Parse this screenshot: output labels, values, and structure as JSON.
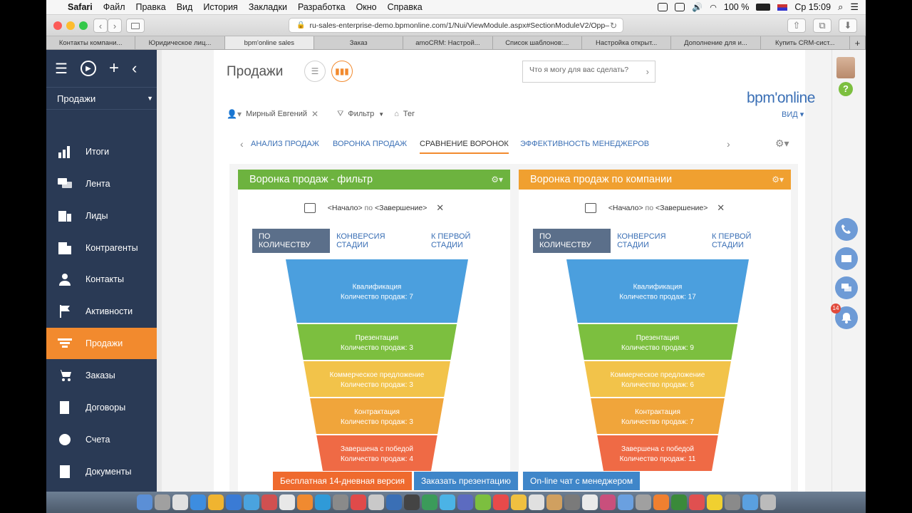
{
  "menubar": {
    "items": [
      "Safari",
      "Файл",
      "Правка",
      "Вид",
      "История",
      "Закладки",
      "Разработка",
      "Окно",
      "Справка"
    ],
    "battery": "100 %",
    "clock": "Ср 15:09"
  },
  "browser": {
    "url": "ru-sales-enterprise-demo.bpmonline.com/1/Nui/ViewModule.aspx#SectionModuleV2/Opp–",
    "tabs": [
      "Контакты компани...",
      "Юридическое лиц...",
      "bpm'online sales",
      "Заказ",
      "amoCRM: Настрой...",
      "Список шаблонов:...",
      "Настройка открыт...",
      "Дополнение для и...",
      "Купить CRM-сист..."
    ],
    "active_tab": 2
  },
  "sidebar": {
    "section": "Продажи",
    "items": [
      "Итоги",
      "Лента",
      "Лиды",
      "Контрагенты",
      "Контакты",
      "Активности",
      "Продажи",
      "Заказы",
      "Договоры",
      "Счета",
      "Документы"
    ],
    "active_index": 6
  },
  "page": {
    "title": "Продажи",
    "ask_placeholder": "Что я могу для вас сделать?",
    "logo": "bpm'online",
    "view_label": "ВИД",
    "filter_user": "Мирный Евгений",
    "filter_label": "Фильтр",
    "tag_label": "Тег"
  },
  "nav_tabs": [
    "АНАЛИЗ ПРОДАЖ",
    "ВОРОНКА ПРОДАЖ",
    "СРАВНЕНИЕ ВОРОНОК",
    "ЭФФЕКТИВНОСТЬ МЕНЕДЖЕРОВ"
  ],
  "nav_active": 2,
  "colors": {
    "sidebar": "#2a3a55",
    "accent_orange": "#f28a2e",
    "panel_green": "#6db33f",
    "panel_orange": "#f0a030",
    "link_blue": "#3a6fb5",
    "stage_1": "#4b9fde",
    "stage_2": "#7cbf3f",
    "stage_3": "#f2c34a",
    "stage_4": "#f0a53b",
    "stage_5": "#ef6a45"
  },
  "panels": [
    {
      "title": "Воронка продаж - фильтр",
      "date_range": {
        "start": "<Начало>",
        "sep": "по",
        "end": "<Завершение>"
      },
      "buttons": [
        "ПО КОЛИЧЕСТВУ",
        "КОНВЕРСИЯ СТАДИИ",
        "К ПЕРВОЙ СТАДИИ"
      ]
    },
    {
      "title": "Воронка продаж по компании",
      "date_range": {
        "start": "<Начало>",
        "sep": "по",
        "end": "<Завершение>"
      },
      "buttons": [
        "ПО КОЛИЧЕСТВУ",
        "КОНВЕРСИЯ СТАДИИ",
        "К ПЕРВОЙ СТАДИИ"
      ]
    }
  ],
  "chart_data": [
    {
      "type": "funnel",
      "title": "Воронка продаж - фильтр",
      "stages": [
        {
          "name": "Квалификация",
          "label": "Количество продаж: 7",
          "value": 7
        },
        {
          "name": "Презентация",
          "label": "Количество продаж: 3",
          "value": 3
        },
        {
          "name": "Коммерческое предложение",
          "label": "Количество продаж: 3",
          "value": 3
        },
        {
          "name": "Контрактация",
          "label": "Количество продаж: 3",
          "value": 3
        },
        {
          "name": "Завершена с победой",
          "label": "Количество продаж: 4",
          "value": 4
        }
      ]
    },
    {
      "type": "funnel",
      "title": "Воронка продаж по компании",
      "stages": [
        {
          "name": "Квалификация",
          "label": "Количество продаж: 17",
          "value": 17
        },
        {
          "name": "Презентация",
          "label": "Количество продаж: 9",
          "value": 9
        },
        {
          "name": "Коммерческое предложение",
          "label": "Количество продаж: 6",
          "value": 6
        },
        {
          "name": "Контрактация",
          "label": "Количество продаж: 7",
          "value": 7
        },
        {
          "name": "Завершена с победой",
          "label": "Количество продаж: 11",
          "value": 11
        }
      ]
    }
  ],
  "banners": [
    "Бесплатная 14-дневная версия",
    "Заказать презентацию",
    "On-line чат с менеджером"
  ],
  "notifications_count": "14"
}
